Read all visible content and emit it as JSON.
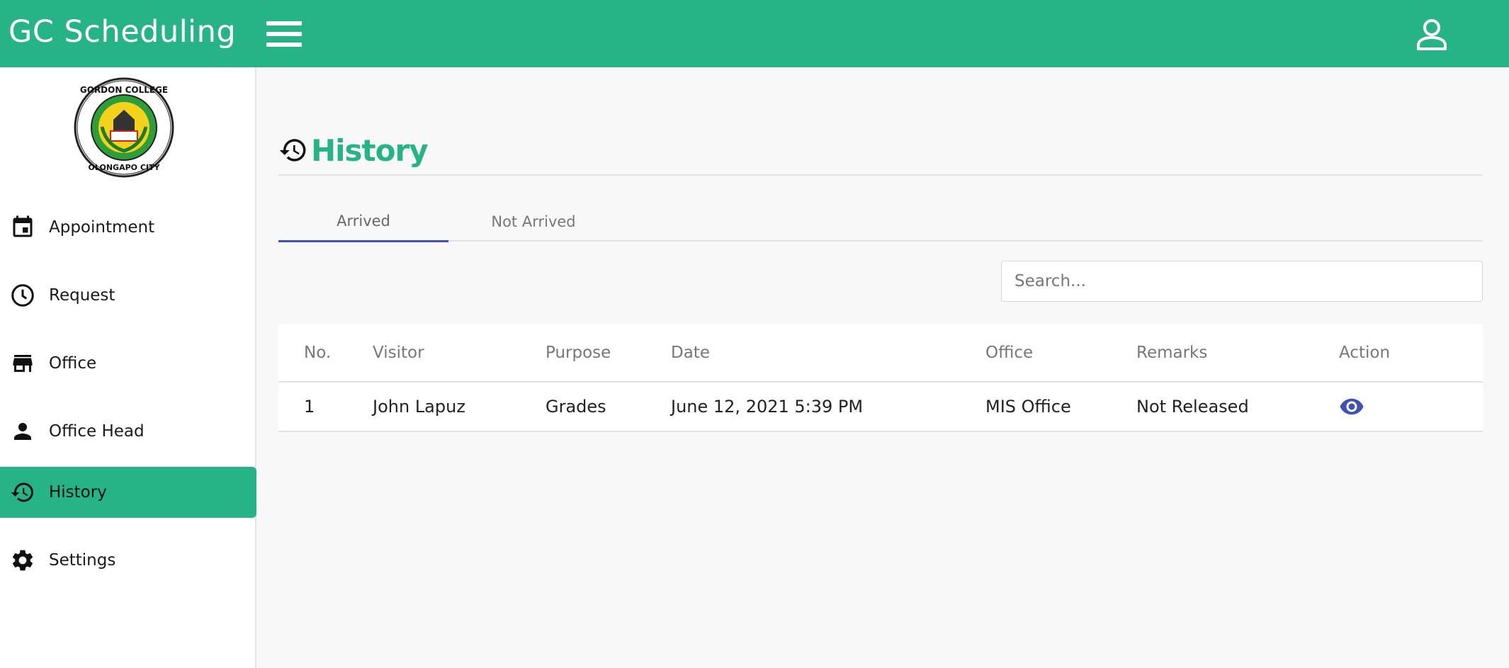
{
  "app": {
    "title": "GC Scheduling"
  },
  "colors": {
    "brand": "#25b387",
    "tab_indicator": "#3f51b5",
    "action_icon": "#3f51b5"
  },
  "header": {
    "menu_icon": "hamburger-icon",
    "user_icon": "user-icon"
  },
  "sidebar": {
    "logo_icon": "gordon-college-seal",
    "items": [
      {
        "label": "Appointment",
        "icon": "calendar-icon"
      },
      {
        "label": "Request",
        "icon": "clock-icon"
      },
      {
        "label": "Office",
        "icon": "store-icon"
      },
      {
        "label": "Office Head",
        "icon": "person-icon"
      },
      {
        "label": "History",
        "icon": "history-icon",
        "active": true
      },
      {
        "label": "Settings",
        "icon": "gear-icon"
      }
    ]
  },
  "page": {
    "title": "History",
    "icon": "history-icon"
  },
  "tabs": [
    {
      "label": "Arrived",
      "active": true
    },
    {
      "label": "Not Arrived",
      "active": false
    }
  ],
  "search": {
    "placeholder": "Search..."
  },
  "table": {
    "columns": [
      "No.",
      "Visitor",
      "Purpose",
      "Date",
      "Office",
      "Remarks",
      "Action"
    ],
    "rows": [
      {
        "no": "1",
        "visitor": "John Lapuz",
        "purpose": "Grades",
        "date": "June 12, 2021 5:39 PM",
        "office": "MIS Office",
        "remarks": "Not Released",
        "action_icon": "eye-icon"
      }
    ]
  }
}
